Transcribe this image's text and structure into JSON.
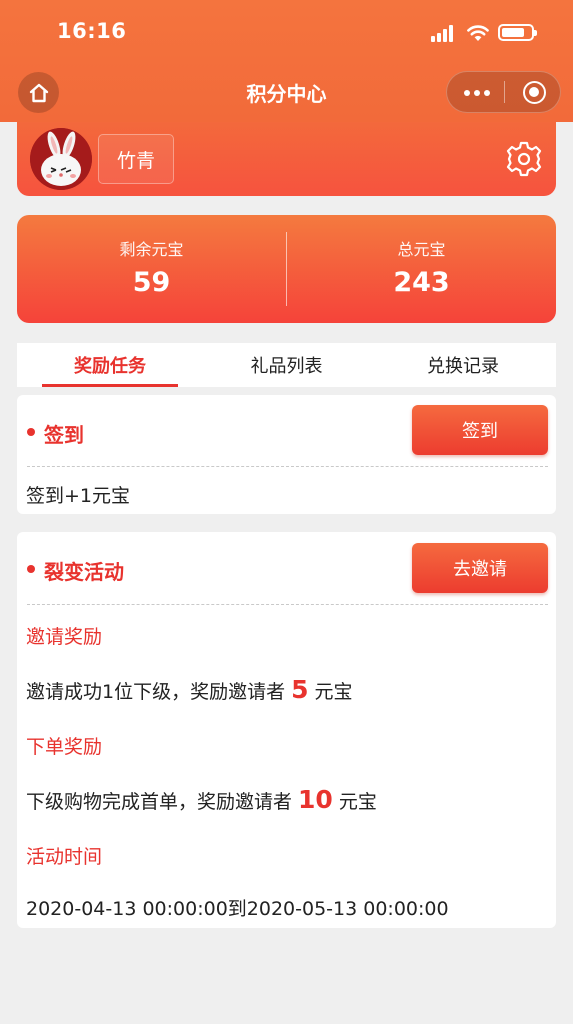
{
  "status_bar": {
    "time": "16:16"
  },
  "nav": {
    "title": "积分中心"
  },
  "user": {
    "name": "竹青"
  },
  "stats": [
    {
      "label": "剩余元宝",
      "value": "59"
    },
    {
      "label": "总元宝",
      "value": "243"
    }
  ],
  "tabs": [
    {
      "label": "奖励任务",
      "active": true
    },
    {
      "label": "礼品列表",
      "active": false
    },
    {
      "label": "兑换记录",
      "active": false
    }
  ],
  "checkin": {
    "title": "签到",
    "button": "签到",
    "desc": "签到+1元宝"
  },
  "invite": {
    "title": "裂变活动",
    "button": "去邀请",
    "invite_reward_title": "邀请奖励",
    "invite_reward_prefix": "邀请成功1位下级，奖励邀请者",
    "invite_reward_amount": "5",
    "invite_reward_unit": "元宝",
    "order_reward_title": "下单奖励",
    "order_reward_prefix": "下级购物完成首单，奖励邀请者",
    "order_reward_amount": "10",
    "order_reward_unit": "元宝",
    "period_title": "活动时间",
    "period": "2020-04-13 00:00:00到2020-05-13 00:00:00"
  },
  "colors": {
    "brand": "#f26a3a",
    "accent": "#e8332e",
    "background": "#efefef"
  }
}
